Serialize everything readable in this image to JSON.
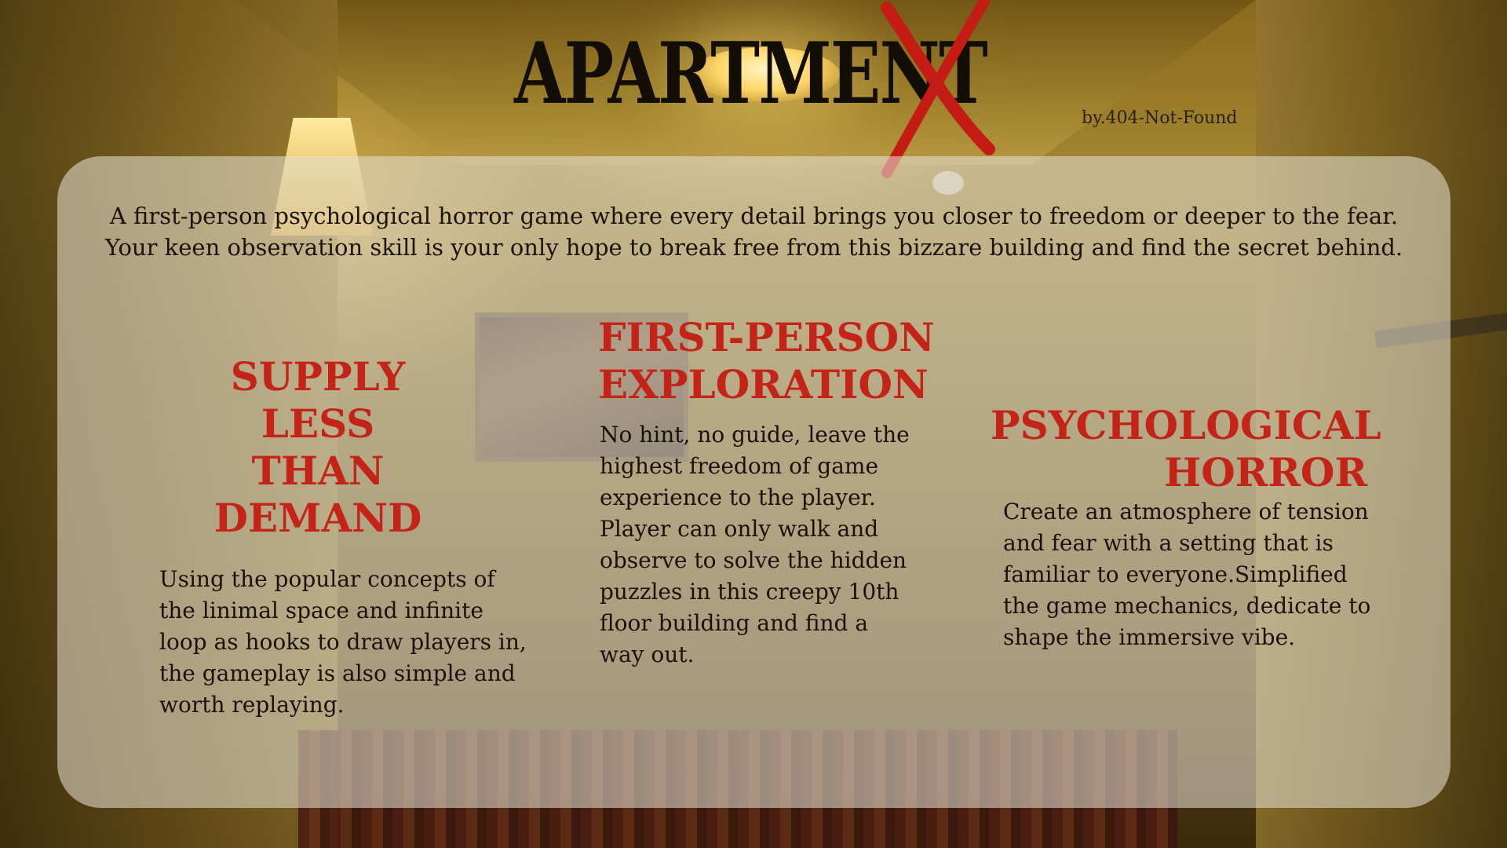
{
  "title": {
    "text": "APARTMENT",
    "x_letter": "X",
    "byline": "by.404-Not-Found"
  },
  "intro": {
    "line1": "A first-person psychological horror game where every detail brings you closer to freedom or deeper to the fear.",
    "line2": "Your keen observation skill is your only hope to break free from this bizzare building and find the secret behind."
  },
  "features": [
    {
      "title_lines": [
        "SUPPLY",
        "LESS",
        "THAN",
        "DEMAND"
      ],
      "body_lines": [
        "Using the popular concepts of",
        "the linimal space and infinite",
        "loop as hooks to draw players in,",
        "the gameplay is also simple and",
        "worth replaying."
      ]
    },
    {
      "title_lines": [
        "FIRST-PERSON",
        "EXPLORATION"
      ],
      "body_lines": [
        "No hint, no guide, leave the",
        "highest freedom of game",
        "experience to the player.",
        "Player can only walk and",
        "observe to solve the hidden",
        "puzzles in this creepy 10th",
        "floor building and find a",
        "way out."
      ]
    },
    {
      "title_lines": [
        "PSYCHOLOGICAL",
        "HORROR"
      ],
      "body_lines": [
        "Create an atmosphere of tension",
        "and fear with a setting that is",
        "familiar to everyone.Simplified",
        "the game mechanics, dedicate to",
        "shape the immersive vibe."
      ]
    }
  ],
  "colors": {
    "accent_red": "#c42418",
    "title_black": "#120d05"
  }
}
